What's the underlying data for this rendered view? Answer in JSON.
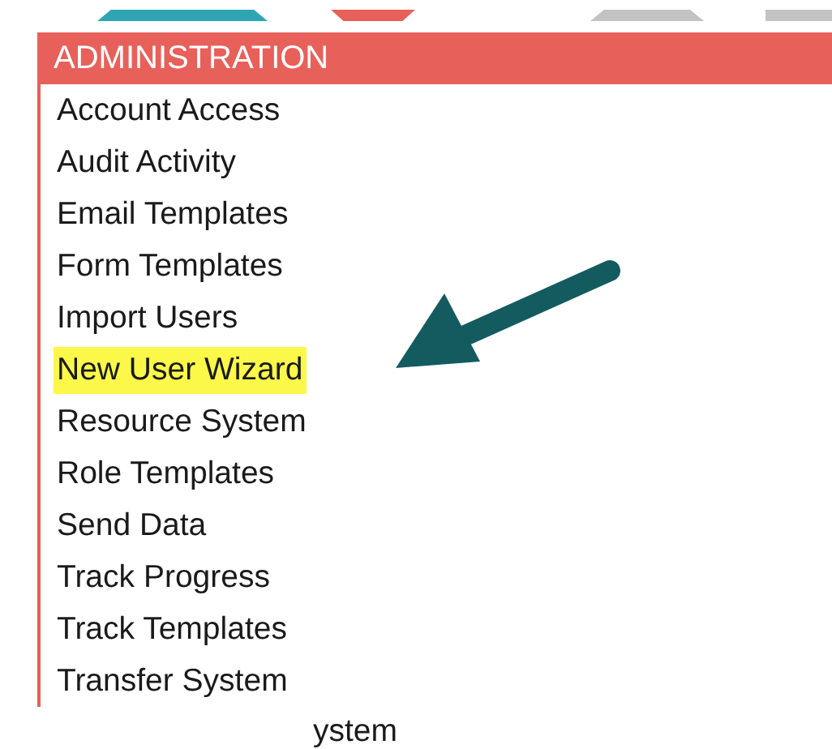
{
  "menu": {
    "title": "ADMINISTRATION",
    "items": [
      {
        "label": "Account Access",
        "highlighted": false
      },
      {
        "label": "Audit Activity",
        "highlighted": false
      },
      {
        "label": "Email Templates",
        "highlighted": false
      },
      {
        "label": "Form Templates",
        "highlighted": false
      },
      {
        "label": "Import Users",
        "highlighted": false
      },
      {
        "label": "New User Wizard",
        "highlighted": true
      },
      {
        "label": "Resource System",
        "highlighted": false
      },
      {
        "label": "Role Templates",
        "highlighted": false
      },
      {
        "label": "Send Data",
        "highlighted": false
      },
      {
        "label": "Track Progress",
        "highlighted": false
      },
      {
        "label": "Track Templates",
        "highlighted": false
      },
      {
        "label": "Transfer System",
        "highlighted": false
      }
    ]
  },
  "below_text": "ystem"
}
